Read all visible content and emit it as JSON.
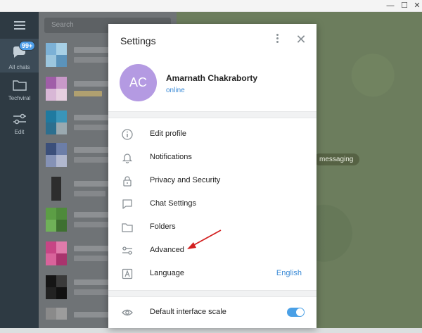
{
  "rail": {
    "badge": "99+",
    "items": [
      {
        "label": "All chats"
      },
      {
        "label": "Techviral"
      },
      {
        "label": "Edit"
      }
    ]
  },
  "chatlist": {
    "search_placeholder": "Search"
  },
  "background": {
    "message_pill": "messaging"
  },
  "dialog": {
    "title": "Settings",
    "profile": {
      "initials": "AC",
      "name": "Amarnath Chakraborty",
      "status": "online"
    },
    "menu": [
      {
        "label": "Edit profile",
        "icon": "info-icon"
      },
      {
        "label": "Notifications",
        "icon": "bell-icon"
      },
      {
        "label": "Privacy and Security",
        "icon": "lock-icon"
      },
      {
        "label": "Chat Settings",
        "icon": "chat-bubble-icon"
      },
      {
        "label": "Folders",
        "icon": "folder-icon"
      },
      {
        "label": "Advanced",
        "icon": "sliders-icon"
      },
      {
        "label": "Language",
        "icon": "language-icon",
        "value": "English"
      }
    ],
    "scale": {
      "label": "Default interface scale",
      "icon": "eye-icon",
      "enabled": true
    }
  },
  "colors": {
    "accent": "#3a8ad6",
    "avatar": "#b49ae2",
    "arrow": "#d32020"
  }
}
